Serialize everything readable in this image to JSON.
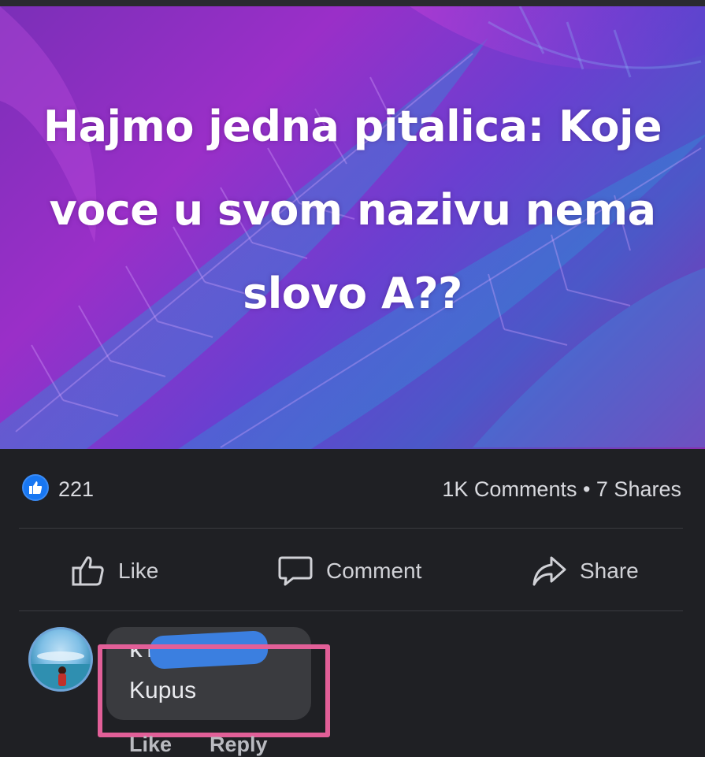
{
  "post": {
    "text": "Hajmo jedna pitalica: Koje voce u svom nazivu nema slovo A??",
    "background_colors": [
      "#7b2fb8",
      "#9a2fc8",
      "#4b58c8"
    ]
  },
  "stats": {
    "likes": "221",
    "engagement": "1K Comments • 7 Shares",
    "like_badge_color": "#1877f2"
  },
  "actions": {
    "like": "Like",
    "comment": "Comment",
    "share": "Share"
  },
  "comment": {
    "name_fragment": "K                      ic",
    "text": "Kupus",
    "like": "Like",
    "reply": "Reply",
    "highlight_color": "#e25f98"
  },
  "icons": {
    "like_badge": "thumbs-up-icon",
    "like_action": "thumbs-up-outline-icon",
    "comment_action": "speech-bubble-icon",
    "share_action": "share-arrow-icon"
  }
}
